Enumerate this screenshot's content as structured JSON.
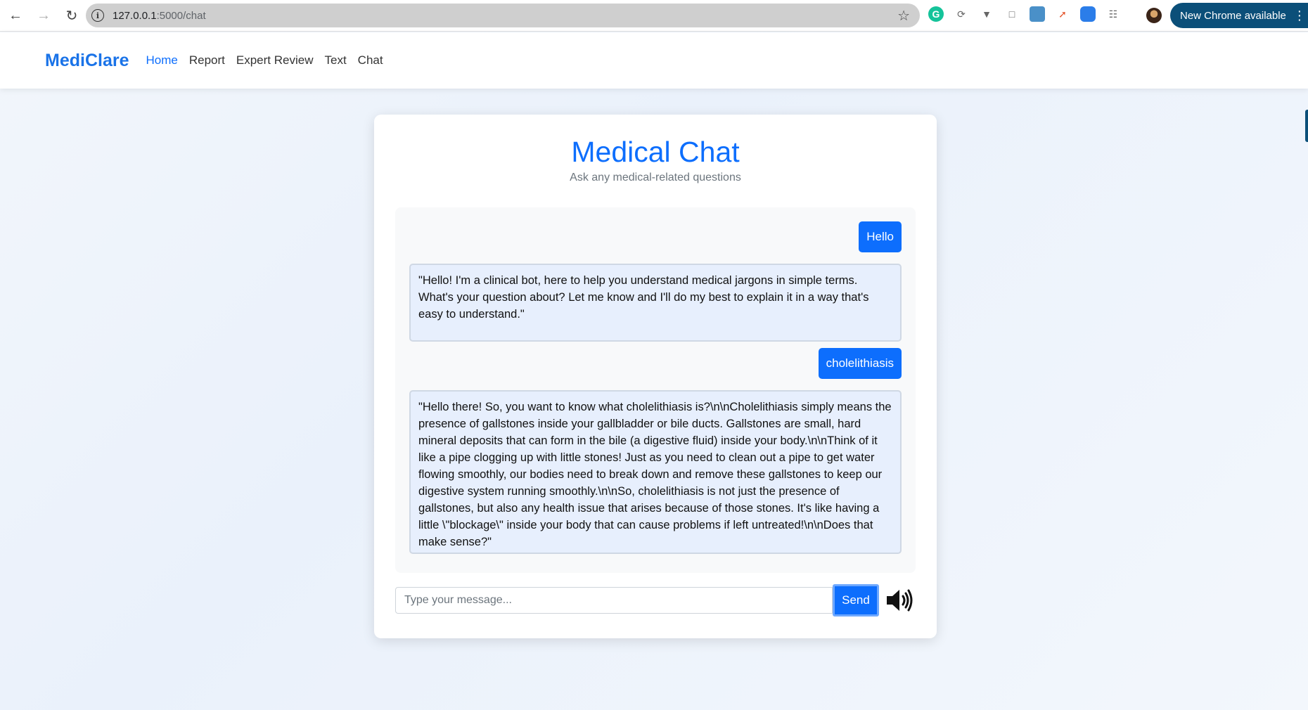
{
  "browser": {
    "url_host": "127.0.0.1",
    "url_path": ":5000/chat",
    "update_label": "New Chrome available"
  },
  "nav": {
    "brand": "MediClare",
    "links": [
      "Home",
      "Report",
      "Expert Review",
      "Text",
      "Chat"
    ]
  },
  "chat": {
    "title": "Medical Chat",
    "subtitle": "Ask any medical-related questions",
    "messages": [
      {
        "role": "user",
        "text": "Hello"
      },
      {
        "role": "bot",
        "text": "\"Hello! I'm a clinical bot, here to help you understand medical jargons in simple terms. What's your question about? Let me know and I'll do my best to explain it in a way that's easy to understand.\""
      },
      {
        "role": "user",
        "text": "cholelithiasis"
      },
      {
        "role": "bot",
        "text": "\"Hello there! So, you want to know what cholelithiasis is?\\n\\nCholelithiasis simply means the presence of gallstones inside your gallbladder or bile ducts. Gallstones are small, hard mineral deposits that can form in the bile (a digestive fluid) inside your body.\\n\\nThink of it like a pipe clogging up with little stones! Just as you need to clean out a pipe to get water flowing smoothly, our bodies need to break down and remove these gallstones to keep our digestive system running smoothly.\\n\\nSo, cholelithiasis is not just the presence of gallstones, but also any health issue that arises because of those stones. It's like having a little \\\"blockage\\\" inside your body that can cause problems if left untreated!\\n\\nDoes that make sense?\""
      }
    ],
    "input_placeholder": "Type your message...",
    "send_label": "Send"
  }
}
